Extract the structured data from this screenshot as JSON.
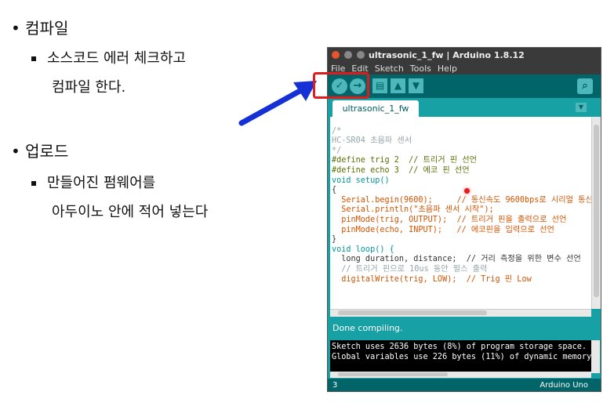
{
  "slide": {
    "bullet1": "컴파일",
    "sub1_line1": "소스코드 에러 체크하고",
    "sub1_line2": "컴파일 한다.",
    "bullet2": "업로드",
    "sub2_line1": "만들어진 펌웨어를",
    "sub2_line2": "아두이노 안에 적어 넣는다"
  },
  "window": {
    "title": "ultrasonic_1_fw | Arduino 1.8.12",
    "menu": [
      "File",
      "Edit",
      "Sketch",
      "Tools",
      "Help"
    ],
    "toolbar_icons": [
      "verify-icon",
      "upload-icon",
      "new-icon",
      "open-icon",
      "save-icon",
      "serial-monitor-icon"
    ],
    "tab": "ultrasonic_1_fw",
    "status": "Done compiling.",
    "console": [
      "Sketch uses 2636 bytes (8%) of program storage space.",
      "Global variables use 226 bytes (11%) of dynamic memory"
    ],
    "line_number": "3",
    "board": "Arduino Uno"
  },
  "code": [
    "/*",
    "HC-SR04 초음파 센서",
    "*/",
    "",
    "#define trig 2  // 트리거 핀 선언",
    "#define echo 3  // 에코 핀 선언",
    "",
    "void setup()",
    "{",
    "  Serial.begin(9600);     // 통신속도 9600bps로 시리얼 통신",
    "  Serial.println(\"초음파 센서 시작\");",
    "  pinMode(trig, OUTPUT);  // 트리거 핀을 출력으로 선언",
    "  pinMode(echo, INPUT);   // 에코핀을 입력으로 선언",
    "}",
    "",
    "void loop() {",
    "  long duration, distance;  // 거리 측정을 위한 변수 선언",
    "  // 트리거 핀으로 10us 동안 펄스 출력",
    "  digitalWrite(trig, LOW);  // Trig 핀 Low"
  ],
  "colors": {
    "teal": "#17a1a5",
    "dark_teal": "#006468",
    "highlight_box": "#e01b1b",
    "arrow": "#1531d6"
  }
}
